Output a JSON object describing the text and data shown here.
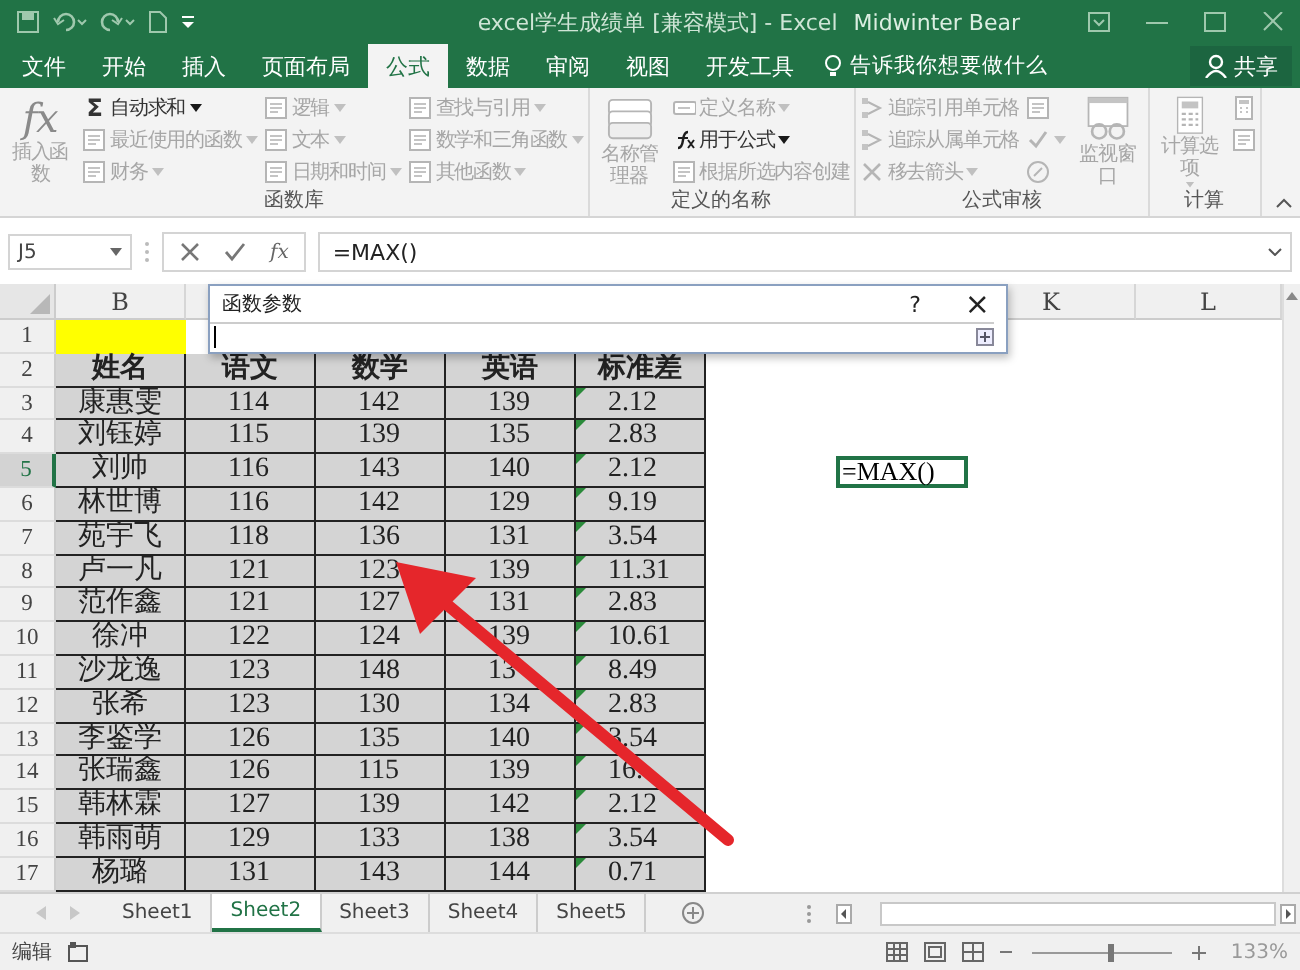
{
  "window": {
    "title": "excel学生成绩单  [兼容模式]  -  Excel",
    "user": "Midwinter Bear"
  },
  "tabs": [
    {
      "label": "文件",
      "selected": false
    },
    {
      "label": "开始",
      "selected": false
    },
    {
      "label": "插入",
      "selected": false
    },
    {
      "label": "页面布局",
      "selected": false
    },
    {
      "label": "公式",
      "selected": true
    },
    {
      "label": "数据",
      "selected": false
    },
    {
      "label": "审阅",
      "selected": false
    },
    {
      "label": "视图",
      "selected": false
    },
    {
      "label": "开发工具",
      "selected": false
    }
  ],
  "tell_me": "告诉我你想要做什么",
  "share": "共享",
  "ribbon": [
    {
      "label": "函数库",
      "items": [
        {
          "kind": "large",
          "symbol": "fx",
          "label": "插入函数",
          "disabled": true,
          "dropdown": false
        },
        {
          "kind": "small",
          "symbol": "Σ",
          "label": "自动求和",
          "disabled": false,
          "dropdown": true
        },
        {
          "kind": "small",
          "label": "最近使用的函数",
          "disabled": true,
          "dropdown": true
        },
        {
          "kind": "small",
          "label": "财务",
          "disabled": true,
          "dropdown": true
        },
        {
          "kind": "small",
          "label": "逻辑",
          "disabled": true,
          "dropdown": true
        },
        {
          "kind": "small",
          "label": "文本",
          "disabled": true,
          "dropdown": true
        },
        {
          "kind": "small",
          "label": "日期和时间",
          "disabled": true,
          "dropdown": true
        },
        {
          "kind": "small",
          "label": "查找与引用",
          "disabled": true,
          "dropdown": true
        },
        {
          "kind": "small",
          "label": "数学和三角函数",
          "disabled": true,
          "dropdown": true
        },
        {
          "kind": "small",
          "label": "其他函数",
          "disabled": true,
          "dropdown": true
        }
      ]
    },
    {
      "label": "定义的名称",
      "items": [
        {
          "kind": "large",
          "label": "名称管理器",
          "disabled": true,
          "dropdown": false
        },
        {
          "kind": "small",
          "label": "定义名称",
          "disabled": true,
          "dropdown": true
        },
        {
          "kind": "small",
          "label": "用于公式",
          "disabled": false,
          "dropdown": true
        },
        {
          "kind": "small",
          "label": "根据所选内容创建",
          "disabled": true,
          "dropdown": false
        }
      ]
    },
    {
      "label": "公式审核",
      "items": [
        {
          "kind": "small",
          "label": "追踪引用单元格",
          "disabled": true,
          "dropdown": false
        },
        {
          "kind": "small",
          "label": "追踪从属单元格",
          "disabled": true,
          "dropdown": false
        },
        {
          "kind": "small",
          "label": "移去箭头",
          "disabled": true,
          "dropdown": true
        },
        {
          "kind": "icon",
          "disabled": true,
          "dropdown": false
        },
        {
          "kind": "icon",
          "disabled": true,
          "dropdown": true
        },
        {
          "kind": "icon",
          "disabled": true,
          "dropdown": false
        },
        {
          "kind": "large",
          "label": "监视窗口",
          "disabled": true,
          "dropdown": false
        }
      ]
    },
    {
      "label": "计算",
      "items": [
        {
          "kind": "large",
          "label": "计算选项",
          "disabled": true,
          "dropdown": true
        },
        {
          "kind": "icon",
          "disabled": true,
          "dropdown": false
        },
        {
          "kind": "icon",
          "disabled": true,
          "dropdown": false
        }
      ]
    }
  ],
  "formula_bar": {
    "name_box": "J5",
    "fx": "fx",
    "formula": "=MAX()"
  },
  "dialog": {
    "title": "函数参数",
    "help": "?",
    "close": "×"
  },
  "sheet": {
    "column_headers": {
      "B": "B",
      "K": "K",
      "L": "L"
    },
    "row_numbers": [
      {
        "label": "1",
        "selected": false
      },
      {
        "label": "2",
        "selected": false
      },
      {
        "label": "3",
        "selected": false
      },
      {
        "label": "4",
        "selected": false
      },
      {
        "label": "5",
        "selected": true
      },
      {
        "label": "6",
        "selected": false
      },
      {
        "label": "7",
        "selected": false
      },
      {
        "label": "8",
        "selected": false
      },
      {
        "label": "9",
        "selected": false
      },
      {
        "label": "10",
        "selected": false
      },
      {
        "label": "11",
        "selected": false
      },
      {
        "label": "12",
        "selected": false
      },
      {
        "label": "13",
        "selected": false
      },
      {
        "label": "14",
        "selected": false
      },
      {
        "label": "15",
        "selected": false
      },
      {
        "label": "16",
        "selected": false
      },
      {
        "label": "17",
        "selected": false
      }
    ],
    "header": [
      "姓名",
      "语文",
      "数学",
      "英语",
      "标准差"
    ],
    "rows": [
      {
        "cells": [
          "康惠雯",
          "114",
          "142",
          "139",
          "2.12"
        ],
        "flagged": true
      },
      {
        "cells": [
          "刘钰婷",
          "115",
          "139",
          "135",
          "2.83"
        ],
        "flagged": true
      },
      {
        "cells": [
          "刘帅",
          "116",
          "143",
          "140",
          "2.12"
        ],
        "flagged": true
      },
      {
        "cells": [
          "林世博",
          "116",
          "142",
          "129",
          "9.19"
        ],
        "flagged": true
      },
      {
        "cells": [
          "苑宇飞",
          "118",
          "136",
          "131",
          "3.54"
        ],
        "flagged": true
      },
      {
        "cells": [
          "卢一凡",
          "121",
          "123",
          "139",
          "11.31"
        ],
        "flagged": true
      },
      {
        "cells": [
          "范作鑫",
          "121",
          "127",
          "131",
          "2.83"
        ],
        "flagged": true
      },
      {
        "cells": [
          "徐冲",
          "122",
          "124",
          "139",
          "10.61"
        ],
        "flagged": true
      },
      {
        "cells": [
          "沙龙逸",
          "123",
          "148",
          "13",
          "8.49"
        ],
        "flagged": true
      },
      {
        "cells": [
          "张希",
          "123",
          "130",
          "134",
          "2.83"
        ],
        "flagged": true
      },
      {
        "cells": [
          "李鉴学",
          "126",
          "135",
          "140",
          "3.54"
        ],
        "flagged": true
      },
      {
        "cells": [
          "张瑞鑫",
          "126",
          "115",
          "139",
          "16."
        ],
        "flagged": true
      },
      {
        "cells": [
          "韩林霖",
          "127",
          "139",
          "142",
          "2.12"
        ],
        "flagged": true
      },
      {
        "cells": [
          "韩雨萌",
          "129",
          "133",
          "138",
          "3.54"
        ],
        "flagged": true
      },
      {
        "cells": [
          "杨璐",
          "131",
          "143",
          "144",
          "0.71"
        ],
        "flagged": true
      }
    ],
    "active_cell": "=MAX()"
  },
  "sheet_tabs": [
    {
      "label": "Sheet1",
      "selected": false
    },
    {
      "label": "Sheet2",
      "selected": true
    },
    {
      "label": "Sheet3",
      "selected": false
    },
    {
      "label": "Sheet4",
      "selected": false
    },
    {
      "label": "Sheet5",
      "selected": false
    }
  ],
  "status_bar": {
    "mode": "编辑",
    "zoom": "133%",
    "zoom_slider": {
      "level": 0.55
    }
  }
}
